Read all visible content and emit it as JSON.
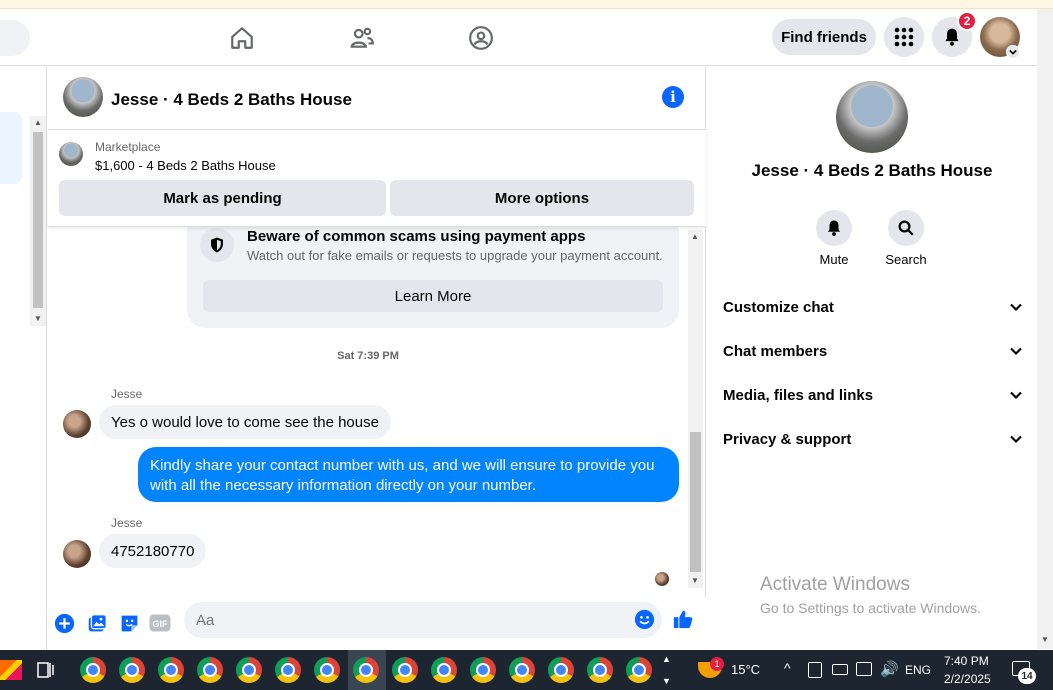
{
  "topnav": {
    "find_friends": "Find friends",
    "notification_count": "2"
  },
  "chat": {
    "title": "Jesse · 4 Beds 2 Baths House",
    "marketplace": {
      "label": "Marketplace",
      "price_line": "$1,600 - 4 Beds 2 Baths House",
      "mark_pending": "Mark as pending",
      "more_options": "More options"
    },
    "scam_notice": {
      "title": "Beware of common scams using payment apps",
      "subtitle": "Watch out for fake emails or requests to upgrade your payment account.",
      "learn_more": "Learn More"
    },
    "timestamp": "Sat 7:39 PM",
    "messages": [
      {
        "sender": "Jesse",
        "text": "Yes o would love to come see the house",
        "direction": "in"
      },
      {
        "sender": "",
        "text": "Kindly share your contact number with us, and we will ensure to provide you with all the necessary information directly on your number.",
        "direction": "out"
      },
      {
        "sender": "Jesse",
        "text": "4752180770",
        "direction": "in"
      }
    ],
    "composer_placeholder": "Aa",
    "gif_label": "GIF"
  },
  "right_panel": {
    "name": "Jesse · 4 Beds 2 Baths House",
    "actions": {
      "mute": "Mute",
      "search": "Search"
    },
    "sections": [
      "Customize chat",
      "Chat members",
      "Media, files and links",
      "Privacy & support"
    ]
  },
  "watermark": {
    "line1": "Activate Windows",
    "line2": "Go to Settings to activate Windows."
  },
  "taskbar": {
    "weather": "15°C",
    "weather_badge": "1",
    "language": "ENG",
    "time": "7:40 PM",
    "date": "2/2/2025",
    "notifications": "14"
  },
  "colors": {
    "accent_blue": "#0866ff",
    "outgoing_bubble": "#0084ff",
    "badge_red": "#e41e3f",
    "taskbar_bg": "#1c2530"
  }
}
